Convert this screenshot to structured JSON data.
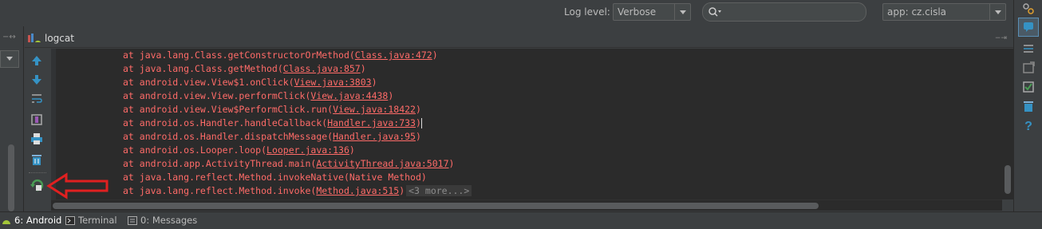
{
  "toolbar": {
    "log_level_label": "Log level:",
    "log_level_value": "Verbose",
    "search_placeholder": "",
    "app_filter_value": "app: cz.cisla"
  },
  "panel": {
    "title": "logcat"
  },
  "log": {
    "lines": [
      {
        "prefix": "at java.lang.Class.getConstructorOrMethod(",
        "link": "Class.java:472",
        "suffix": ")"
      },
      {
        "prefix": "at java.lang.Class.getMethod(",
        "link": "Class.java:857",
        "suffix": ")"
      },
      {
        "prefix": "at android.view.View$1.onClick(",
        "link": "View.java:3803",
        "suffix": ")"
      },
      {
        "prefix": "at android.view.View.performClick(",
        "link": "View.java:4438",
        "suffix": ")"
      },
      {
        "prefix": "at android.view.View$PerformClick.run(",
        "link": "View.java:18422",
        "suffix": ")"
      },
      {
        "prefix": "at android.os.Handler.handleCallback(",
        "link": "Handler.java:733",
        "suffix": ")"
      },
      {
        "prefix": "at android.os.Handler.dispatchMessage(",
        "link": "Handler.java:95",
        "suffix": ")"
      },
      {
        "prefix": "at android.os.Looper.loop(",
        "link": "Looper.java:136",
        "suffix": ")"
      },
      {
        "prefix": "at android.app.ActivityThread.main(",
        "link": "ActivityThread.java:5017",
        "suffix": ")"
      },
      {
        "prefix": "at java.lang.reflect.Method.invokeNative(Native Method)",
        "link": "",
        "suffix": ""
      },
      {
        "prefix": "at java.lang.reflect.Method.invoke(",
        "link": "Method.java:515",
        "suffix": ")"
      }
    ],
    "more_label": "<3 more...>"
  },
  "bottom_tabs": [
    {
      "label": "6: Android",
      "icon": "android-icon"
    },
    {
      "label": "Terminal",
      "icon": "terminal-icon"
    },
    {
      "label": "0: Messages",
      "icon": "messages-icon"
    }
  ],
  "colors": {
    "log_error": "#ff6b68",
    "background": "#3c3f41",
    "console_bg": "#2b2b2b",
    "annotation_arrow": "#e02020"
  }
}
